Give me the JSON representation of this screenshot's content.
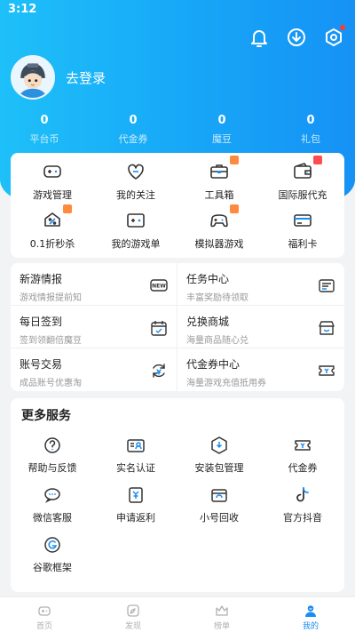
{
  "status_bar": {
    "time": "3:12"
  },
  "header": {
    "icons": [
      "bell-icon",
      "download-icon",
      "settings-icon"
    ],
    "login_text": "去登录"
  },
  "stats": [
    {
      "value": "0",
      "label": "平台币"
    },
    {
      "value": "0",
      "label": "代金券"
    },
    {
      "value": "0",
      "label": "魔豆"
    },
    {
      "value": "0",
      "label": "礼包"
    }
  ],
  "quick_grid": [
    {
      "label": "游戏管理",
      "icon": "gamepad-icon"
    },
    {
      "label": "我的关注",
      "icon": "heart-icon"
    },
    {
      "label": "工具箱",
      "icon": "toolbox-icon"
    },
    {
      "label": "国际服代充",
      "icon": "wallet-icon"
    },
    {
      "label": "0.1折秒杀",
      "icon": "discount-icon"
    },
    {
      "label": "我的游戏单",
      "icon": "game-list-icon"
    },
    {
      "label": "模拟器游戏",
      "icon": "emulator-icon"
    },
    {
      "label": "福利卡",
      "icon": "card-icon"
    }
  ],
  "list_grid": [
    {
      "title": "新游情报",
      "subtitle": "游戏情报提前知",
      "icon": "new-badge-icon",
      "icon_text": "NEW"
    },
    {
      "title": "任务中心",
      "subtitle": "丰富奖励待领取",
      "icon": "task-icon"
    },
    {
      "title": "每日签到",
      "subtitle": "签到领翻倍魔豆",
      "icon": "calendar-check-icon"
    },
    {
      "title": "兑换商城",
      "subtitle": "海量商品随心兑",
      "icon": "store-icon"
    },
    {
      "title": "账号交易",
      "subtitle": "成品账号优惠淘",
      "icon": "trade-icon"
    },
    {
      "title": "代金券中心",
      "subtitle": "海量游戏充值抵用券",
      "icon": "coupon-icon"
    }
  ],
  "more_services": {
    "title": "更多服务",
    "items": [
      {
        "label": "帮助与反馈",
        "icon": "help-icon"
      },
      {
        "label": "实名认证",
        "icon": "id-card-icon"
      },
      {
        "label": "安装包管理",
        "icon": "package-icon"
      },
      {
        "label": "代金券",
        "icon": "voucher-icon"
      },
      {
        "label": "微信客服",
        "icon": "wechat-icon"
      },
      {
        "label": "申请返利",
        "icon": "rebate-icon"
      },
      {
        "label": "小号回收",
        "icon": "recycle-icon"
      },
      {
        "label": "官方抖音",
        "icon": "douyin-icon"
      },
      {
        "label": "谷歌框架",
        "icon": "google-icon"
      }
    ]
  },
  "tabbar": [
    {
      "label": "首页",
      "icon": "home-game-icon",
      "active": false
    },
    {
      "label": "发现",
      "icon": "discover-icon",
      "active": false
    },
    {
      "label": "榜单",
      "icon": "crown-icon",
      "active": false
    },
    {
      "label": "我的",
      "icon": "user-icon",
      "active": true
    }
  ],
  "colors": {
    "accent": "#1a8cf2",
    "hero_start": "#1ec0f9",
    "hero_end": "#1692f5",
    "badge_orange": "#ff8a3d",
    "badge_red": "#ff4d4f"
  }
}
